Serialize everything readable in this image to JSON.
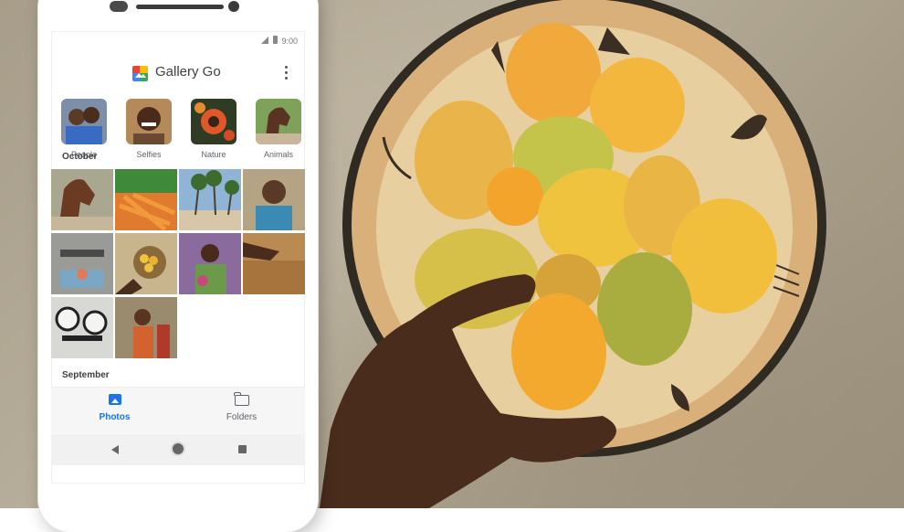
{
  "status_bar": {
    "time": "9:00"
  },
  "app_bar": {
    "title": "Gallery Go",
    "menu_icon": "more-vert-icon"
  },
  "categories": [
    {
      "label": "People"
    },
    {
      "label": "Selfies"
    },
    {
      "label": "Nature"
    },
    {
      "label": "Animals"
    }
  ],
  "sections": {
    "october": "October",
    "september": "September"
  },
  "bottom_nav": {
    "photos": {
      "label": "Photos",
      "icon": "photos-icon",
      "color": "#1a73e8"
    },
    "folders": {
      "label": "Folders",
      "icon": "folder-icon"
    }
  },
  "system_nav": {
    "back": "back-icon",
    "home": "home-icon",
    "recents": "recents-icon"
  },
  "colors": {
    "accent": "#1a73e8",
    "text_primary": "#3c4043",
    "text_secondary": "#5f6368"
  }
}
